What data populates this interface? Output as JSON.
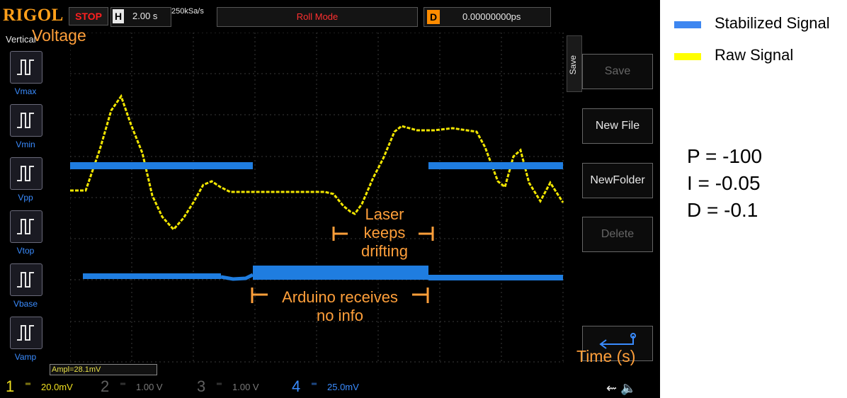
{
  "scope": {
    "brand": "RIGOL",
    "run_state": "STOP",
    "timebase_label": "H",
    "timebase_value": "2.00 s",
    "sample_rate": "250kSa/s",
    "mode": "Roll Mode",
    "delay_label": "D",
    "delay_value": "0.00000000ps",
    "vertical_label": "Vertical",
    "measurements": [
      {
        "label": "Vmax",
        "icon": "vmax-icon"
      },
      {
        "label": "Vmin",
        "icon": "vmin-icon"
      },
      {
        "label": "Vpp",
        "icon": "vpp-icon"
      },
      {
        "label": "Vtop",
        "icon": "vtop-icon"
      },
      {
        "label": "Vbase",
        "icon": "vbase-icon"
      },
      {
        "label": "Vamp",
        "icon": "vamp-icon"
      }
    ],
    "menu_title": "Save",
    "softkeys": [
      {
        "label": "Save",
        "enabled": false
      },
      {
        "label": "New File",
        "enabled": true
      },
      {
        "label": "NewFolder",
        "enabled": true
      },
      {
        "label": "Delete",
        "enabled": false
      }
    ],
    "readout": "Ampl=28.1mV",
    "channels": [
      {
        "num": "1",
        "scale": "20.0mV",
        "color": "#f0e020",
        "active": true
      },
      {
        "num": "2",
        "scale": "1.00 V",
        "color": "#606060",
        "active": false
      },
      {
        "num": "3",
        "scale": "1.00 V",
        "color": "#606060",
        "active": false
      },
      {
        "num": "4",
        "scale": "25.0mV",
        "color": "#3a8cff",
        "active": true
      }
    ],
    "trace_colors": {
      "raw": "#f2e600",
      "stabilized": "#1f7de0"
    }
  },
  "annotations": {
    "voltage": "Voltage",
    "time": "Time (s)",
    "laser_line1": "Laser",
    "laser_line2": "keeps",
    "laser_line3": "drifting",
    "arduino_line1": "Arduino receives",
    "arduino_line2": "no info"
  },
  "legend": [
    {
      "label": "Stabilized Signal",
      "color": "#3d86f0"
    },
    {
      "label": "Raw Signal",
      "color": "#ffff00"
    }
  ],
  "pid": {
    "p": "P = -100",
    "i": "I = -0.05",
    "d": "D = -0.1"
  }
}
